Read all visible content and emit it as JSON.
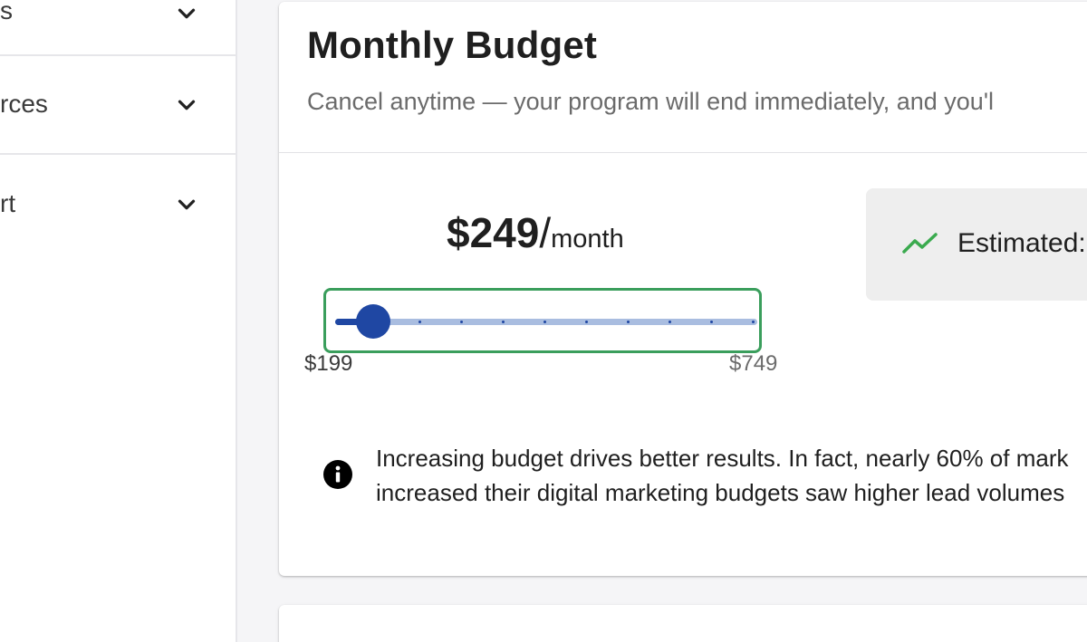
{
  "sidebar": {
    "items": [
      {
        "label": "s",
        "icon": "chevron-down-icon"
      },
      {
        "label": "rces",
        "icon": "chevron-down-icon"
      },
      {
        "label": "rt",
        "icon": "chevron-down-icon"
      }
    ]
  },
  "budget": {
    "title": "Monthly Budget",
    "subtitle": "Cancel anytime — your program will end immediately, and you'l",
    "price_amount": "$249",
    "price_slash": "/",
    "price_period": "month",
    "slider": {
      "min_label": "$199",
      "max_label": "$749",
      "value_fraction": 0.091,
      "tick_count": 11
    },
    "estimate_label": "Estimated:",
    "estimate_icon": "trending-up-icon",
    "info_icon": "info-icon",
    "info_lines": [
      "Increasing budget drives better results. In fact, nearly 60% of mark",
      "increased their digital marketing budgets saw higher lead volumes"
    ]
  },
  "colors": {
    "slider_active": "#1f47a3",
    "slider_inactive": "#a9bde0",
    "focus_ring": "#3a9e5c",
    "trend_green": "#3aaa4e"
  }
}
